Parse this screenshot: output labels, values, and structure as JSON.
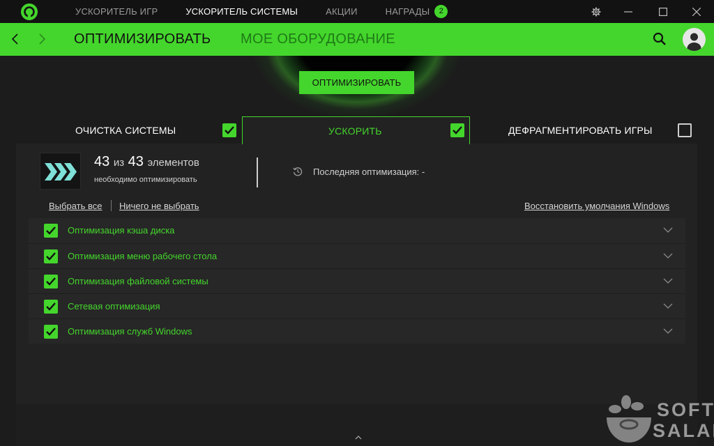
{
  "titlebar": {
    "tabs": [
      {
        "label": "УСКОРИТЕЛЬ ИГР",
        "active": false
      },
      {
        "label": "УСКОРИТЕЛЬ СИСТЕМЫ",
        "active": true
      },
      {
        "label": "АКЦИИ",
        "active": false
      },
      {
        "label": "НАГРАДЫ",
        "active": false,
        "badge": "2"
      }
    ],
    "icons": [
      "razer-cortex-logo-icon",
      "gear-icon",
      "minimize-icon",
      "maximize-icon",
      "close-icon"
    ]
  },
  "greenbar": {
    "tabs": [
      {
        "label": "ОПТИМИЗИРОВАТЬ",
        "active": true
      },
      {
        "label": "МОЕ ОБОРУДОВАНИЕ",
        "active": false
      }
    ],
    "icons": [
      "back-arrow-icon",
      "forward-arrow-icon",
      "search-icon",
      "user-avatar-icon"
    ]
  },
  "hero": {
    "optimize_button": "ОПТИМИЗИРОВАТЬ"
  },
  "subtabs": [
    {
      "label": "ОЧИСТКА СИСТЕМЫ",
      "checked": true,
      "active": false
    },
    {
      "label": "УСКОРИТЬ",
      "checked": true,
      "active": true
    },
    {
      "label": "ДЕФРАГМЕНТИРОВАТЬ ИГРЫ",
      "checked": false,
      "active": false
    }
  ],
  "summary": {
    "count_done": "43",
    "count_of": "из",
    "count_total": "43",
    "count_unit": "элементов",
    "subtitle": "необходимо оптимизировать",
    "last_optimization_label": "Последняя оптимизация:",
    "last_optimization_value": "-"
  },
  "actions": {
    "select_all": "Выбрать все",
    "select_none": "Ничего не выбрать",
    "restore_defaults": "Восстановить умолчания Windows"
  },
  "items": [
    {
      "label": "Оптимизация кэша диска",
      "checked": true
    },
    {
      "label": "Оптимизация меню рабочего стола",
      "checked": true
    },
    {
      "label": "Оптимизация файловой системы",
      "checked": true
    },
    {
      "label": "Сетевая оптимизация",
      "checked": true
    },
    {
      "label": "Оптимизация служб Windows",
      "checked": true
    }
  ],
  "watermark": {
    "line1": "SOFT",
    "line2": "SALAD"
  },
  "colors": {
    "accent": "#44d62c",
    "titlebar": "#121212",
    "panel": "#222222",
    "background": "#1c1c1c"
  }
}
